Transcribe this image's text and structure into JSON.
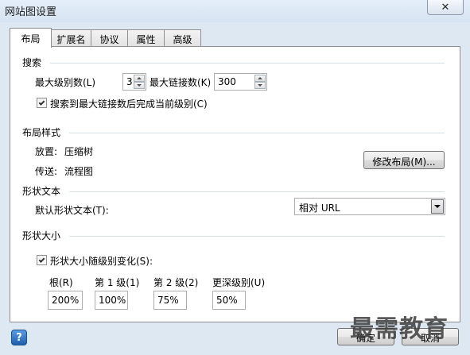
{
  "window": {
    "title": "网站图设置",
    "close_glyph": "✕"
  },
  "tabs": [
    {
      "label": "布局",
      "active": true
    },
    {
      "label": "扩展名",
      "active": false
    },
    {
      "label": "协议",
      "active": false
    },
    {
      "label": "属性",
      "active": false
    },
    {
      "label": "高级",
      "active": false
    }
  ],
  "search": {
    "heading": "搜索",
    "max_level_label": "最大级别数(L)",
    "max_level_value": "3",
    "max_links_label": "最大链接数(K)",
    "max_links_value": "300",
    "complete_level_label": "搜索到最大链接数后完成当前级别(C)",
    "complete_level_checked": true
  },
  "layout_style": {
    "heading": "布局样式",
    "placement_label": "放置:",
    "placement_value": "压缩树",
    "routing_label": "传送:",
    "routing_value": "流程图",
    "modify_button": "修改布局(M)..."
  },
  "shape_text": {
    "heading": "形状文本",
    "default_label": "默认形状文本(T):",
    "default_value": "相对 URL"
  },
  "shape_size": {
    "heading": "形状大小",
    "vary_label": "形状大小随级别变化(S):",
    "vary_checked": true,
    "levels": [
      {
        "label": "根(R)",
        "value": "200%"
      },
      {
        "label": "第 1 级(1)",
        "value": "100%"
      },
      {
        "label": "第 2 级(2)",
        "value": "75%"
      },
      {
        "label": "更深级别(U)",
        "value": "50%"
      }
    ]
  },
  "footer": {
    "help_glyph": "?",
    "ok_label": "确定",
    "cancel_label": "取消",
    "watermark": "最需教育"
  },
  "icons": {
    "close": "close-icon",
    "help": "help-icon",
    "spin_up": "chevron-up-icon",
    "spin_down": "chevron-down-icon",
    "dropdown": "chevron-down-icon",
    "checkbox": "checkmark-icon"
  }
}
